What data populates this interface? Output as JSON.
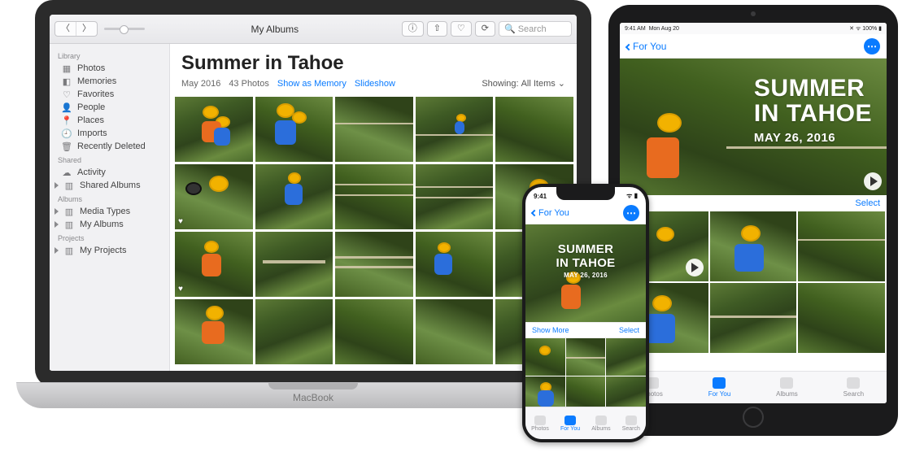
{
  "mac": {
    "base_label": "MacBook",
    "toolbar_title": "My Albums",
    "search_placeholder": "Search",
    "sidebar": {
      "groups": [
        {
          "header": "Library",
          "items": [
            {
              "label": "Photos"
            },
            {
              "label": "Memories"
            },
            {
              "label": "Favorites"
            },
            {
              "label": "People"
            },
            {
              "label": "Places"
            },
            {
              "label": "Imports"
            },
            {
              "label": "Recently Deleted"
            }
          ]
        },
        {
          "header": "Shared",
          "items": [
            {
              "label": "Activity"
            },
            {
              "label": "Shared Albums",
              "disclosure": true
            }
          ]
        },
        {
          "header": "Albums",
          "items": [
            {
              "label": "Media Types",
              "disclosure": true
            },
            {
              "label": "My Albums",
              "disclosure": true
            }
          ]
        },
        {
          "header": "Projects",
          "items": [
            {
              "label": "My Projects",
              "disclosure": true
            }
          ]
        }
      ]
    },
    "album": {
      "title": "Summer in Tahoe",
      "date": "May 2016",
      "count": "43 Photos",
      "action_memory": "Show as Memory",
      "action_slideshow": "Slideshow",
      "showing_label": "Showing:",
      "showing_value": "All Items"
    }
  },
  "ipad": {
    "status_time": "9:41 AM",
    "status_date": "Mon Aug 20",
    "status_icons": "✕ ᯤ 100% ▮",
    "back_label": "For You",
    "hero_l1": "SUMMER",
    "hero_l2": "IN TAHOE",
    "hero_l3": "MAY 26, 2016",
    "select_label": "Select",
    "tabs": [
      "Photos",
      "For You",
      "Albums",
      "Search"
    ],
    "selected_tab": 1
  },
  "iphone": {
    "status_time": "9:41",
    "back_label": "For You",
    "hero_l1": "SUMMER",
    "hero_l2": "IN TAHOE",
    "hero_l3": "MAY 26, 2016",
    "show_more": "Show More",
    "select_label": "Select",
    "tabs": [
      "Photos",
      "For You",
      "Albums",
      "Search"
    ],
    "selected_tab": 1
  }
}
